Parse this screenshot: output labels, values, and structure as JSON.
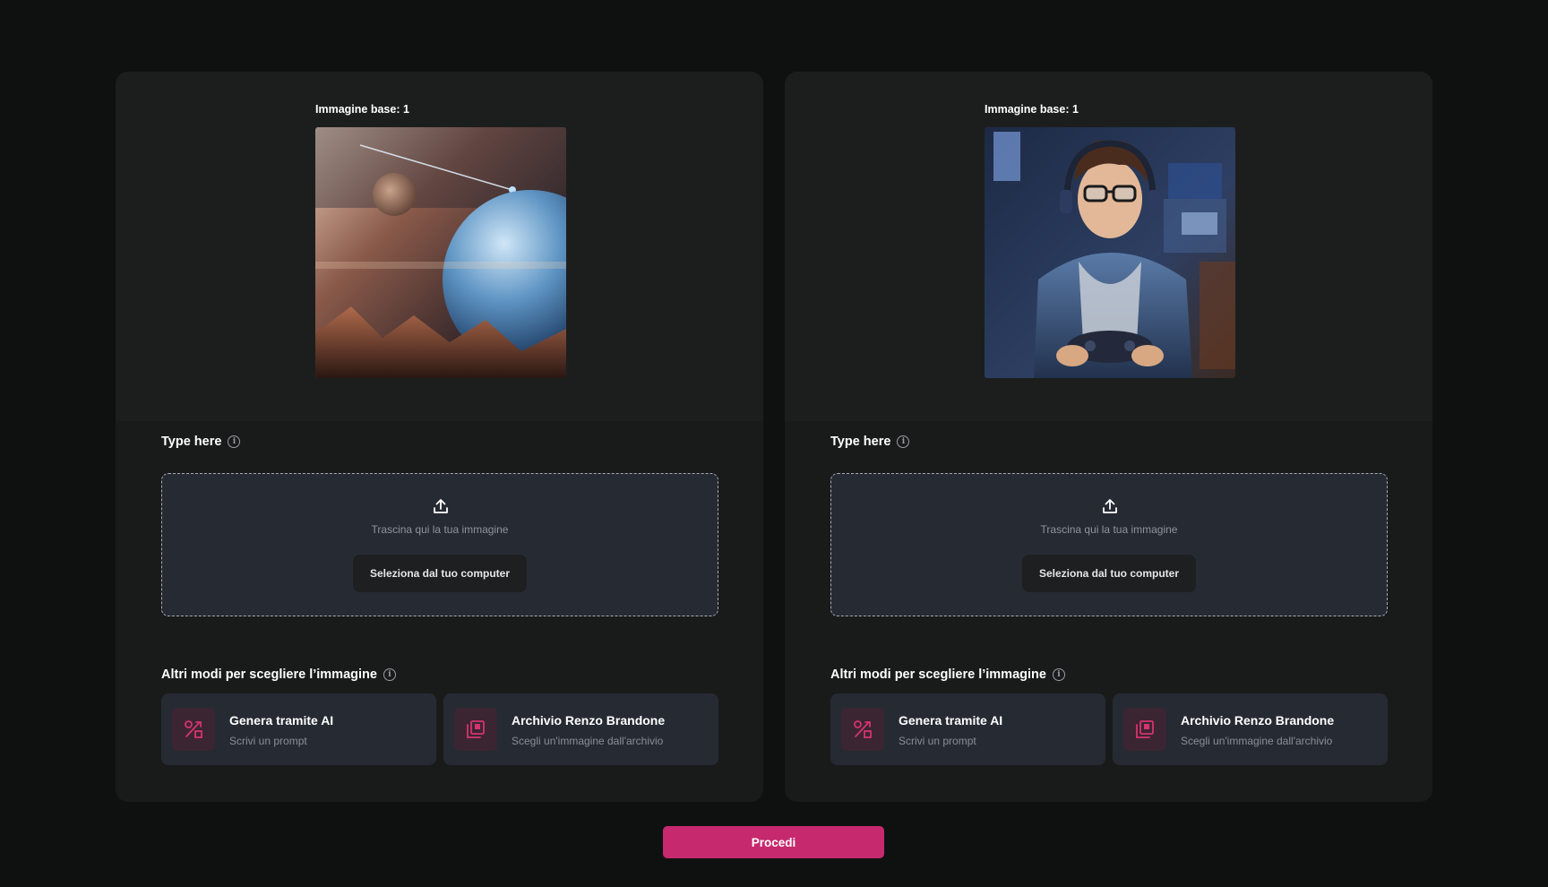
{
  "colors": {
    "page_bg": "#0f1111",
    "panel_bg": "#191b1b",
    "card_bg": "#262a33",
    "accent": "#c6296e",
    "icon_accent": "#d6336f"
  },
  "panels": [
    {
      "base_label": "Immagine base: 1",
      "image_subject": "planets-space-scene",
      "upload": {
        "title": "Type here",
        "drop_text": "Trascina qui la tua immagine",
        "select_button": "Seleziona dal tuo computer",
        "icon": "upload-icon"
      },
      "others": {
        "title": "Altri modi per scegliere l’immagine",
        "options": [
          {
            "title": "Genera tramite AI",
            "subtitle": "Scrivi un prompt",
            "icon": "percent-shapes-icon"
          },
          {
            "title": "Archivio Renzo Brandone",
            "subtitle": "Scegli un'immagine dall'archivio",
            "icon": "gallery-stack-icon"
          }
        ]
      }
    },
    {
      "base_label": "Immagine base: 1",
      "image_subject": "gamer-boy-with-headphones",
      "upload": {
        "title": "Type here",
        "drop_text": "Trascina qui la tua immagine",
        "select_button": "Seleziona dal tuo computer",
        "icon": "upload-icon"
      },
      "others": {
        "title": "Altri modi per scegliere l’immagine",
        "options": [
          {
            "title": "Genera tramite AI",
            "subtitle": "Scrivi un prompt",
            "icon": "percent-shapes-icon"
          },
          {
            "title": "Archivio Renzo Brandone",
            "subtitle": "Scegli un'immagine dall'archivio",
            "icon": "gallery-stack-icon"
          }
        ]
      }
    }
  ],
  "proceed_label": "Procedi"
}
